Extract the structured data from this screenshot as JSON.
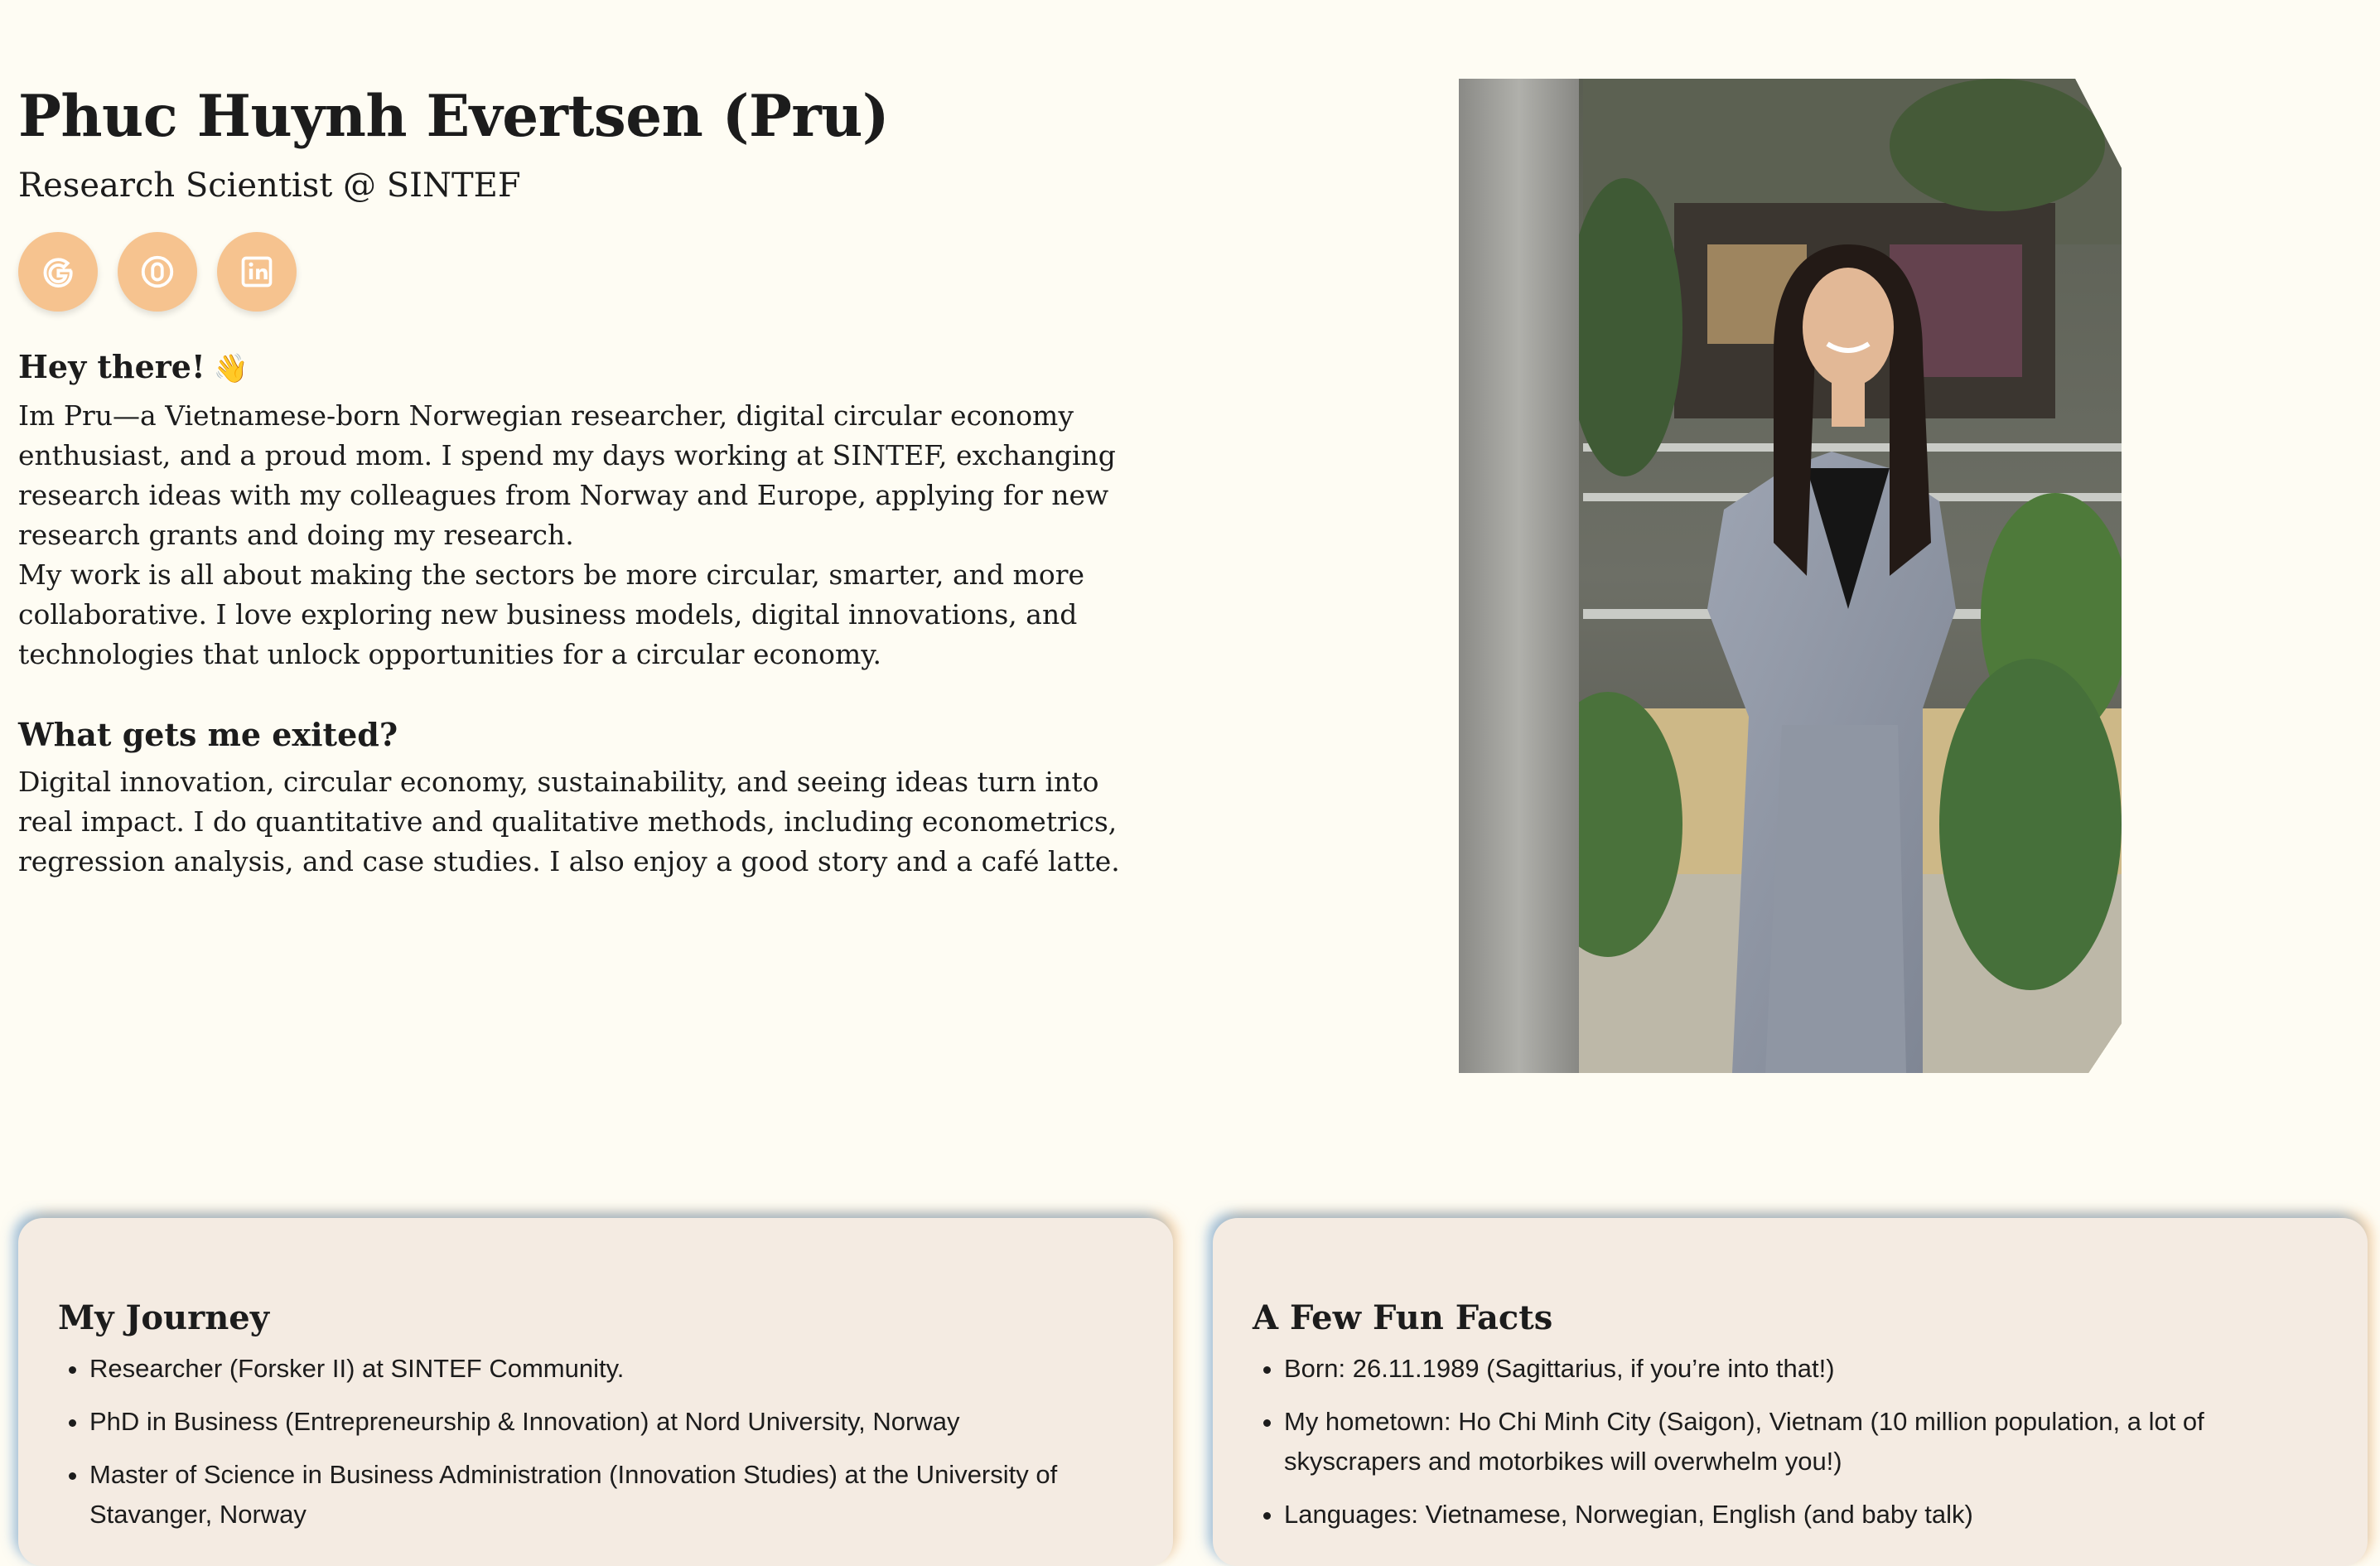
{
  "header": {
    "name": "Phuc Huynh Evertsen (Pru)",
    "role": "Research Scientist @ SINTEF"
  },
  "social": [
    {
      "label": "Google Scholar",
      "icon": "google-scholar-icon"
    },
    {
      "label": "ORCID",
      "icon": "orcid-icon"
    },
    {
      "label": "LinkedIn",
      "icon": "linkedin-icon"
    }
  ],
  "about": {
    "greeting": "Hey there!",
    "greeting_emoji": "👋",
    "paragraph1": "Im Pru—a Vietnamese-born Norwegian researcher, digital circular economy enthusiast, and a proud mom. I spend my days working at SINTEF, exchanging research ideas with my colleagues from Norway and Europe, applying for new research grants and doing my research.",
    "paragraph2": "My work is all about making the sectors be more circular, smarter, and more collaborative. I love exploring new business models, digital innovations, and technologies that unlock opportunities for a circular economy.",
    "excites_heading": "What gets me exited?",
    "excites_text": "Digital innovation, circular economy, sustainability, and seeing ideas turn into real impact. I do quantitative and qualitative methods, including econometrics, regression analysis, and case studies. I also enjoy a good story and a café latte."
  },
  "journey": {
    "title": "My Journey",
    "items": [
      "Researcher (Forsker II) at SINTEF Community.",
      "PhD in Business (Entrepreneurship & Innovation) at Nord University, Norway",
      "Master of Science in Business Administration (Innovation Studies) at the University of Stavanger, Norway"
    ]
  },
  "fun_facts": {
    "title": "A Few Fun Facts",
    "items": [
      "Born: 26.11.1989 (Sagittarius, if you’re into that!)",
      "My hometown: Ho Chi Minh City (Saigon), Vietnam (10 million population, a lot of skyscrapers and motorbikes will overwhelm you!)",
      "Languages: Vietnamese, Norwegian, English (and baby talk)"
    ]
  },
  "colors": {
    "background": "#fefcf3",
    "accent": "#f6c38f",
    "card": "#f4ebe2"
  }
}
